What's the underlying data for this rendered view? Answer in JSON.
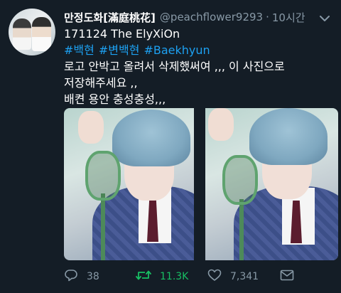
{
  "author": {
    "display_name": "만정도화[滿庭桃花]",
    "handle": "@peachflower9293",
    "separator": "·",
    "time": "10시간"
  },
  "tweet": {
    "line1": "171124 The ElyXiOn",
    "hashtags": [
      "#백현",
      "#변백현",
      "#Baekhyun"
    ],
    "line3": "로고 안박고 올려서 삭제했써여 ,,, 이 사진으로",
    "line4": "저장해주세요 ,,",
    "line5": "배켠 용안 충성충성,,,"
  },
  "actions": {
    "reply_count": "38",
    "retweet_count": "11.3K",
    "like_count": "7,341"
  },
  "icons": {
    "caret": "chevron-down-icon",
    "reply": "reply-icon",
    "retweet": "retweet-icon",
    "like": "heart-icon",
    "dm": "direct-message-icon"
  },
  "colors": {
    "background": "#141d26",
    "hashtag": "#1da1f2",
    "secondary_text": "#8899a6",
    "retweet_active": "#17bf63"
  }
}
